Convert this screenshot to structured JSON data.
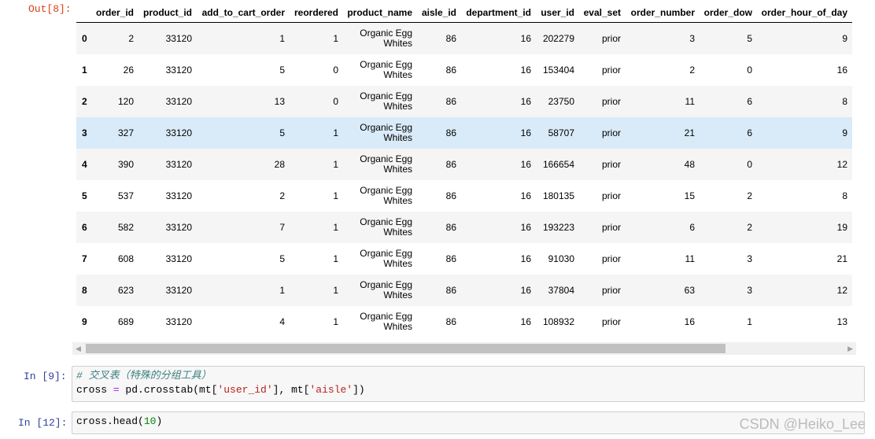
{
  "out_prompt": "Out[8]:",
  "table": {
    "columns": [
      "",
      "order_id",
      "product_id",
      "add_to_cart_order",
      "reordered",
      "product_name",
      "aisle_id",
      "department_id",
      "user_id",
      "eval_set",
      "order_number",
      "order_dow",
      "order_hour_of_day"
    ],
    "rows": [
      [
        "0",
        "2",
        "33120",
        "1",
        "1",
        "Organic Egg Whites",
        "86",
        "16",
        "202279",
        "prior",
        "3",
        "5",
        "9"
      ],
      [
        "1",
        "26",
        "33120",
        "5",
        "0",
        "Organic Egg Whites",
        "86",
        "16",
        "153404",
        "prior",
        "2",
        "0",
        "16"
      ],
      [
        "2",
        "120",
        "33120",
        "13",
        "0",
        "Organic Egg Whites",
        "86",
        "16",
        "23750",
        "prior",
        "11",
        "6",
        "8"
      ],
      [
        "3",
        "327",
        "33120",
        "5",
        "1",
        "Organic Egg Whites",
        "86",
        "16",
        "58707",
        "prior",
        "21",
        "6",
        "9"
      ],
      [
        "4",
        "390",
        "33120",
        "28",
        "1",
        "Organic Egg Whites",
        "86",
        "16",
        "166654",
        "prior",
        "48",
        "0",
        "12"
      ],
      [
        "5",
        "537",
        "33120",
        "2",
        "1",
        "Organic Egg Whites",
        "86",
        "16",
        "180135",
        "prior",
        "15",
        "2",
        "8"
      ],
      [
        "6",
        "582",
        "33120",
        "7",
        "1",
        "Organic Egg Whites",
        "86",
        "16",
        "193223",
        "prior",
        "6",
        "2",
        "19"
      ],
      [
        "7",
        "608",
        "33120",
        "5",
        "1",
        "Organic Egg Whites",
        "86",
        "16",
        "91030",
        "prior",
        "11",
        "3",
        "21"
      ],
      [
        "8",
        "623",
        "33120",
        "1",
        "1",
        "Organic Egg Whites",
        "86",
        "16",
        "37804",
        "prior",
        "63",
        "3",
        "12"
      ],
      [
        "9",
        "689",
        "33120",
        "4",
        "1",
        "Organic Egg Whites",
        "86",
        "16",
        "108932",
        "prior",
        "16",
        "1",
        "13"
      ]
    ],
    "hovered_row": 3
  },
  "cell9": {
    "prompt": "In  [9]:",
    "comment": "# 交叉表（特殊的分组工具）",
    "line2": {
      "a": "cross ",
      "op": "=",
      "b": " pd.crosstab(mt[",
      "s1": "'user_id'",
      "c": "], mt[",
      "s2": "'aisle'",
      "d": "])"
    }
  },
  "cell12": {
    "prompt": "In  [12]:",
    "a": "cross.head(",
    "num": "10",
    "b": ")"
  },
  "watermark": "CSDN @Heiko_Lee"
}
